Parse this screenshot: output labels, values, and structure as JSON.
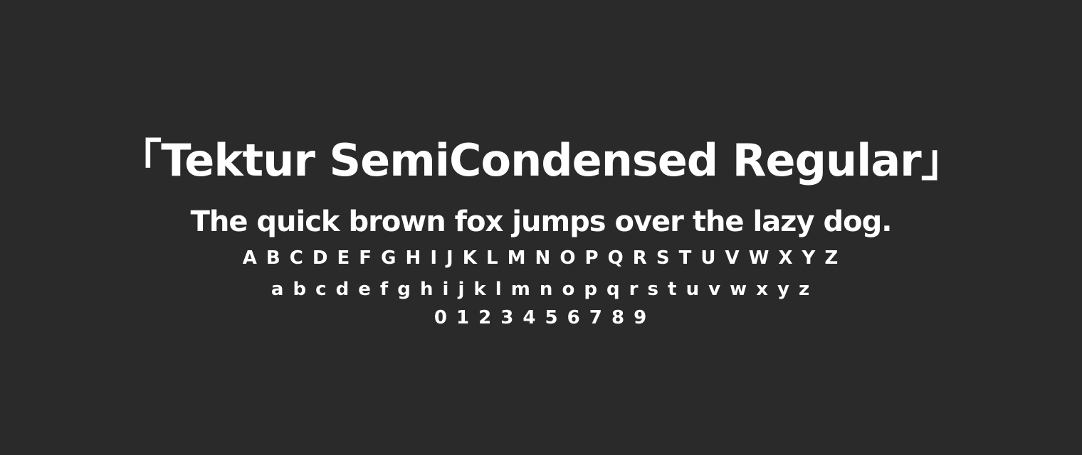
{
  "specimen": {
    "title": "「Tektur SemiCondensed Regular」",
    "pangram": "The quick brown fox jumps over the lazy dog.",
    "uppercase": "A B C D E F G H I J K L M N O P Q R S T U V W X Y Z",
    "lowercase": "a b c d e f g h i j k l m n o p q r s t u v w x y z",
    "digits": "0 1 2 3 4 5 6 7 8 9"
  },
  "colors": {
    "background": "#2a2a2a",
    "text": "#ffffff"
  }
}
